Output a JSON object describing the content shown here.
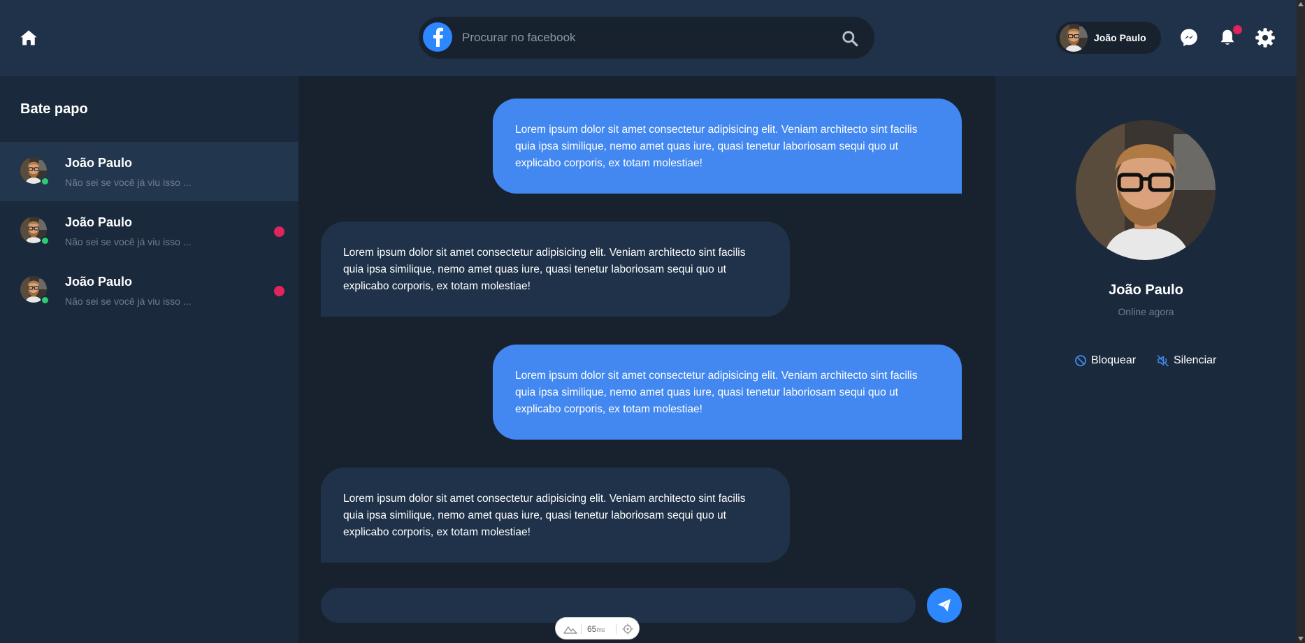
{
  "header": {
    "search_placeholder": "Procurar no facebook",
    "profile_name": "João Paulo"
  },
  "sidebar": {
    "title": "Bate papo",
    "chats": [
      {
        "name": "João Paulo",
        "preview": "Não sei se você já viu isso ...",
        "active": true,
        "unread": false
      },
      {
        "name": "João Paulo",
        "preview": "Não sei se você já viu isso ...",
        "active": false,
        "unread": true
      },
      {
        "name": "João Paulo",
        "preview": "Não sei se você já viu isso ...",
        "active": false,
        "unread": true
      }
    ]
  },
  "messages": [
    {
      "direction": "out",
      "text": "Lorem ipsum dolor sit amet consectetur adipisicing elit. Veniam architecto sint facilis quia ipsa similique, nemo amet quas iure, quasi tenetur laboriosam sequi quo ut explicabo corporis, ex totam molestiae!"
    },
    {
      "direction": "in",
      "text": "Lorem ipsum dolor sit amet consectetur adipisicing elit. Veniam architecto sint facilis quia ipsa similique, nemo amet quas iure, quasi tenetur laboriosam sequi quo ut explicabo corporis, ex totam molestiae!"
    },
    {
      "direction": "out",
      "text": "Lorem ipsum dolor sit amet consectetur adipisicing elit. Veniam architecto sint facilis quia ipsa similique, nemo amet quas iure, quasi tenetur laboriosam sequi quo ut explicabo corporis, ex totam molestiae!"
    },
    {
      "direction": "in",
      "text": "Lorem ipsum dolor sit amet consectetur adipisicing elit. Veniam architecto sint facilis quia ipsa similique, nemo amet quas iure, quasi tenetur laboriosam sequi quo ut explicabo corporis, ex totam molestiae!"
    }
  ],
  "composer": {
    "value": ""
  },
  "perf_widget": {
    "value": "65",
    "unit": "ms"
  },
  "profile_panel": {
    "name": "João Paulo",
    "status": "Online agora",
    "block_label": "Bloquear",
    "mute_label": "Silenciar"
  },
  "colors": {
    "bg": "#18222f",
    "header": "#1f3249",
    "sidebar": "#1a2a3c",
    "accent": "#2d88ff",
    "outgoing_bubble": "#4388f0",
    "incoming_bubble": "#1f3249",
    "online": "#2ecc71",
    "unread": "#e0245e"
  },
  "icons": [
    "home-icon",
    "facebook-logo-icon",
    "search-icon",
    "messenger-icon",
    "bell-icon",
    "gear-icon",
    "send-icon",
    "block-icon",
    "mute-icon",
    "mountain-icon",
    "target-icon"
  ]
}
